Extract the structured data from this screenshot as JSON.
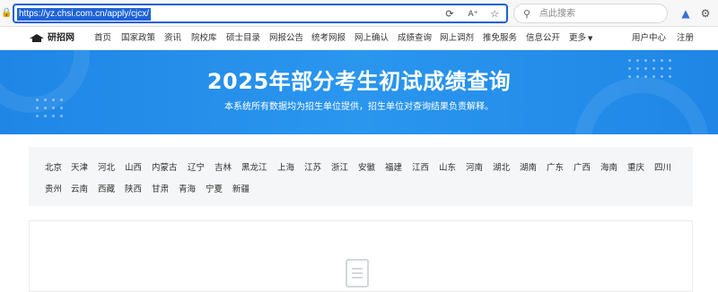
{
  "browser": {
    "url": "https://yz.chsi.com.cn/apply/cjcx/",
    "search_placeholder": "点此搜索"
  },
  "nav": {
    "logo_text": "研招网",
    "items": [
      "首页",
      "国家政策",
      "资讯",
      "院校库",
      "硕士目录",
      "网报公告",
      "统考网报",
      "网上确认",
      "成绩查询",
      "网上调剂",
      "推免服务",
      "信息公开",
      "更多"
    ],
    "user_center": "用户中心",
    "register": "注册"
  },
  "banner": {
    "title": "2025年部分考生初试成绩查询",
    "subtitle": "本系统所有数据均为招生单位提供，招生单位对查询结果负责解释。"
  },
  "provinces": {
    "row1": [
      "北京",
      "天津",
      "河北",
      "山西",
      "内蒙古",
      "辽宁",
      "吉林",
      "黑龙江",
      "上海",
      "江苏",
      "浙江",
      "安徽",
      "福建",
      "江西",
      "山东",
      "河南",
      "湖北",
      "湖南",
      "广东",
      "广西",
      "海南",
      "重庆",
      "四川"
    ],
    "row2": [
      "贵州",
      "云南",
      "西藏",
      "陕西",
      "甘肃",
      "青海",
      "宁夏",
      "新疆"
    ]
  },
  "colors": {
    "banner": "#2a8eea",
    "url_highlight": "#1e63d6",
    "panel_bg": "#f5f6f7"
  }
}
